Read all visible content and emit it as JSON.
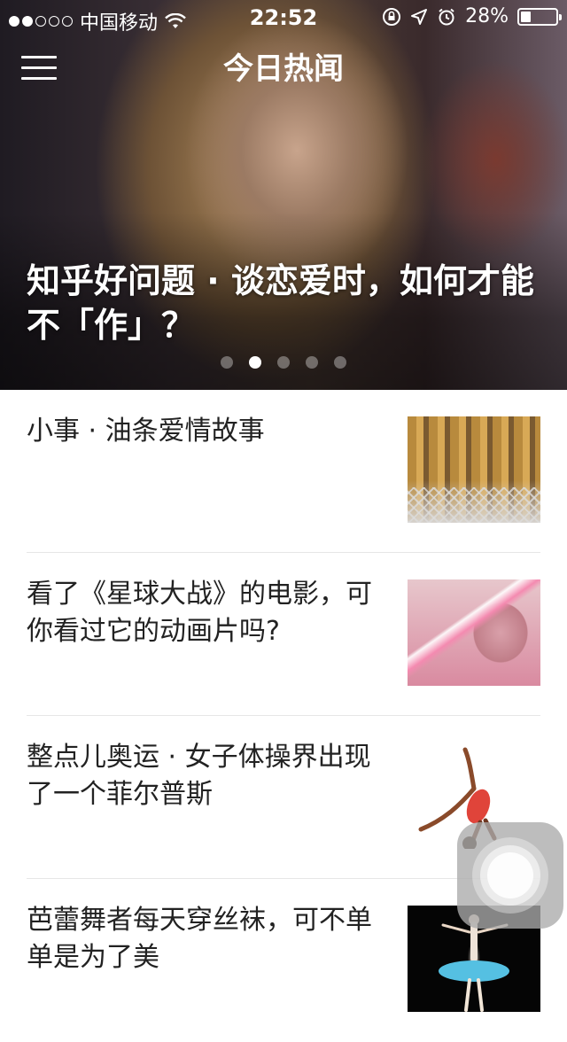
{
  "status_bar": {
    "carrier": "中国移动",
    "time": "22:52",
    "battery_percent_label": "28%",
    "battery_level": 0.28,
    "signal_bars_filled": 2,
    "signal_bars_total": 5,
    "icons": [
      "wifi-icon",
      "orientation-lock-icon",
      "location-icon",
      "alarm-icon",
      "battery-icon"
    ]
  },
  "header": {
    "title": "今日热闻",
    "menu_icon": "hamburger-menu-icon"
  },
  "hero": {
    "title": "知乎好问题 · 谈恋爱时，如何才能不「作」？",
    "page_count": 5,
    "active_page": 2
  },
  "news": [
    {
      "title": "小事 · 油条爱情故事",
      "thumb": "youtiao-photo"
    },
    {
      "title": "看了《星球大战》的电影，可你看过它的动画片吗?",
      "thumb": "star-wars-cartoon"
    },
    {
      "title": "整点儿奥运 · 女子体操界出现了一个菲尔普斯",
      "thumb": "gymnast-photo"
    },
    {
      "title": "芭蕾舞者每天穿丝袜，可不单单是为了美",
      "thumb": "ballet-dancer-photo"
    }
  ],
  "colors": {
    "title_text": "#222222",
    "separator": "#e6e6e6",
    "header_text": "#ffffff"
  }
}
